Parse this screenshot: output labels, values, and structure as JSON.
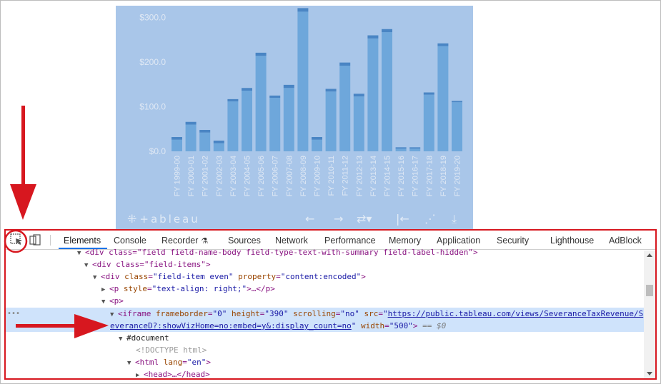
{
  "chart_data": {
    "type": "bar",
    "categories": [
      "FY 1999-00",
      "FY 2000-01",
      "FY 2001-02",
      "FY 2002-03",
      "FY 2003-04",
      "FY 2004-05",
      "FY 2005-06",
      "FY 2006-07",
      "FY 2007-08",
      "FY 2008-09",
      "FY 2009-10",
      "FY 2010-11",
      "FY 2011-12",
      "FY 2012-13",
      "FY 2013-14",
      "FY 2014-15",
      "FY 2015-16",
      "FY 2016-17",
      "FY 2017-18",
      "FY 2018-19",
      "FY 2019-20"
    ],
    "series": [
      {
        "values": [
          26,
          60,
          42,
          18,
          112,
          136,
          214,
          120,
          142,
          313,
          26,
          134,
          192,
          123,
          253,
          267,
          6,
          6,
          127,
          236,
          110
        ]
      },
      {
        "values": [
          6,
          6,
          6,
          6,
          5,
          6,
          7,
          5,
          7,
          8,
          6,
          6,
          7,
          6,
          7,
          7,
          3,
          3,
          5,
          6,
          3
        ]
      }
    ],
    "y_ticks": [
      "$0.0",
      "$100.0",
      "$200.0",
      "$300.0"
    ],
    "ylim": [
      0,
      320
    ],
    "grid": false,
    "legend": "none",
    "colors": {
      "bar_main": "#6ea7db",
      "bar_top": "#4a85c4",
      "background": "#a9c6e9",
      "axis_text": "#dfe8f4"
    }
  },
  "tableau": {
    "logo": "tableau",
    "toolbar_icons": [
      "undo-icon",
      "redo-icon",
      "revert-icon",
      "pause-icon",
      "share-icon",
      "download-icon"
    ]
  },
  "devtools": {
    "tabs": [
      "Elements",
      "Console",
      "Recorder",
      "Sources",
      "Network",
      "Performance",
      "Memory",
      "Application",
      "Security",
      "Lighthouse",
      "AdBlock"
    ],
    "active_tab": "Elements",
    "dom_lines": {
      "l0": "<div class=\"field field-name-body field-type-text-with-summary field-label-hidden\">",
      "l1_tag": "<div class=\"field-items\">",
      "l2_open": "<div ",
      "l2_attr1": "class",
      "l2_val1": "\"field-item even\"",
      "l2_attr2": "property",
      "l2_val2": "\"content:encoded\"",
      "l3_open": "<p ",
      "l3_attr": "style",
      "l3_val": "\"text-align: right;\"",
      "l3_close": ">…</p>",
      "l4": "<p>",
      "l5_open": "<iframe ",
      "l5_a1": "frameborder",
      "l5_v1": "\"0\"",
      "l5_a2": "height",
      "l5_v2": "\"390\"",
      "l5_a3": "scrolling",
      "l5_v3": "\"no\"",
      "l5_a4": "src",
      "l5_url1": "https://public.tableau.com/views/SeveranceTaxRevenue/S",
      "l6_url2": "everanceD?:showVizHome=no:embed=y&:display_count=no",
      "l6_a5": "width",
      "l6_v5": "\"500\"",
      "l6_tail": "== $0",
      "l7": "#document",
      "l8": "<!DOCTYPE html>",
      "l9_open": "<html ",
      "l9_attr": "lang",
      "l9_val": "\"en\"",
      "l10": "<head>…</head>"
    }
  },
  "annotations": {
    "color": "#d7171f"
  }
}
